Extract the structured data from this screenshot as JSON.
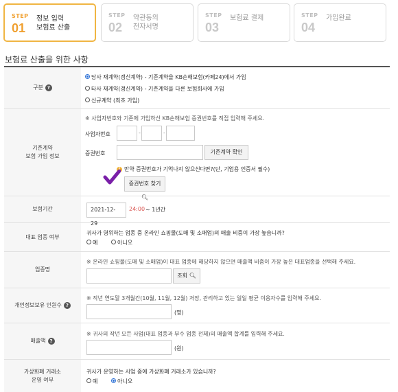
{
  "steps": [
    {
      "label": "STEP",
      "num": "01",
      "line1": "정보 입력",
      "line2": "보험료 산출",
      "active": true
    },
    {
      "label": "STEP",
      "num": "02",
      "line1": "약관동의",
      "line2": "전자서명",
      "active": false
    },
    {
      "label": "STEP",
      "num": "03",
      "line1": "보험료 결제",
      "line2": "",
      "active": false
    },
    {
      "label": "STEP",
      "num": "04",
      "line1": "가입완료",
      "line2": "",
      "active": false
    }
  ],
  "section_title": "보험료 산출을 위한 사항",
  "rows": {
    "gubun": {
      "label": "구분",
      "options": [
        "당사 재계약(갱신계약) - 기존계약을 KB손해보험(카페24)에서 가입",
        "타사 재계약(갱신계약) - 기존계약을 다른 보험회사에 가입",
        "신규계약 (최초 가입)"
      ]
    },
    "existing": {
      "label_line1": "기존계약",
      "label_line2": "보험 가입 정보",
      "note": "※ 사업자번호와 기존에 가입하신 KB손해보험 증권번호를 직접 입력해 주세요.",
      "biz_label": "사업자번호",
      "dash1": "-",
      "dash2": "-",
      "policy_label": "증권번호",
      "confirm_button": "기존계약 확인",
      "warn_text": "만약 증권번호가 기억나지 않으신다면?(단, 기업용 인증서 필수)",
      "find_button": "증권번호 찾기"
    },
    "period": {
      "label": "보험기간",
      "start_date": "2021-12-29",
      "time": "24:00",
      "suffix": "~ 1년간"
    },
    "main_biz": {
      "label": "대표 업종 여부",
      "question": "귀사가 영위하는 업종 중 온라인 쇼핑몰(도매 및 소매업)의 매출 비중이 가장 높습니까?",
      "yes": "예",
      "no": "아니오"
    },
    "industry": {
      "label": "업종명",
      "note": "※ 온라인 쇼핑몰(도매 및 소매업)이 대표 업종에 해당하지 않으면 매출액 비중이 가장 높은 대표업종을 선택해 주세요.",
      "search_button": "조회"
    },
    "privacy": {
      "label": "개인정보보유 인원수",
      "note": "※ 작년 연도말 3개월간(10월, 11월, 12월) 저장, 관리하고 있는 일일 평균 이용자수를 입력해 주세요.",
      "unit": "(명)"
    },
    "sales": {
      "label": "매출액",
      "note": "※ 귀사의 작년 모든 사업(대표 업종과 부수 업종 전체)의 매출액 합계를 입력해 주세요.",
      "unit": "(원)"
    },
    "crypto": {
      "label_line1": "가상화폐 거래소",
      "label_line2": "운영 여부",
      "question": "귀사가 운영하는 사업 중에 가상화폐 거래소가 있습니까?",
      "yes": "예",
      "no": "아니오"
    }
  },
  "colors": {
    "accent": "#f0a030",
    "date_time": "#d9534f",
    "check_mark": "#7a1fa8"
  }
}
